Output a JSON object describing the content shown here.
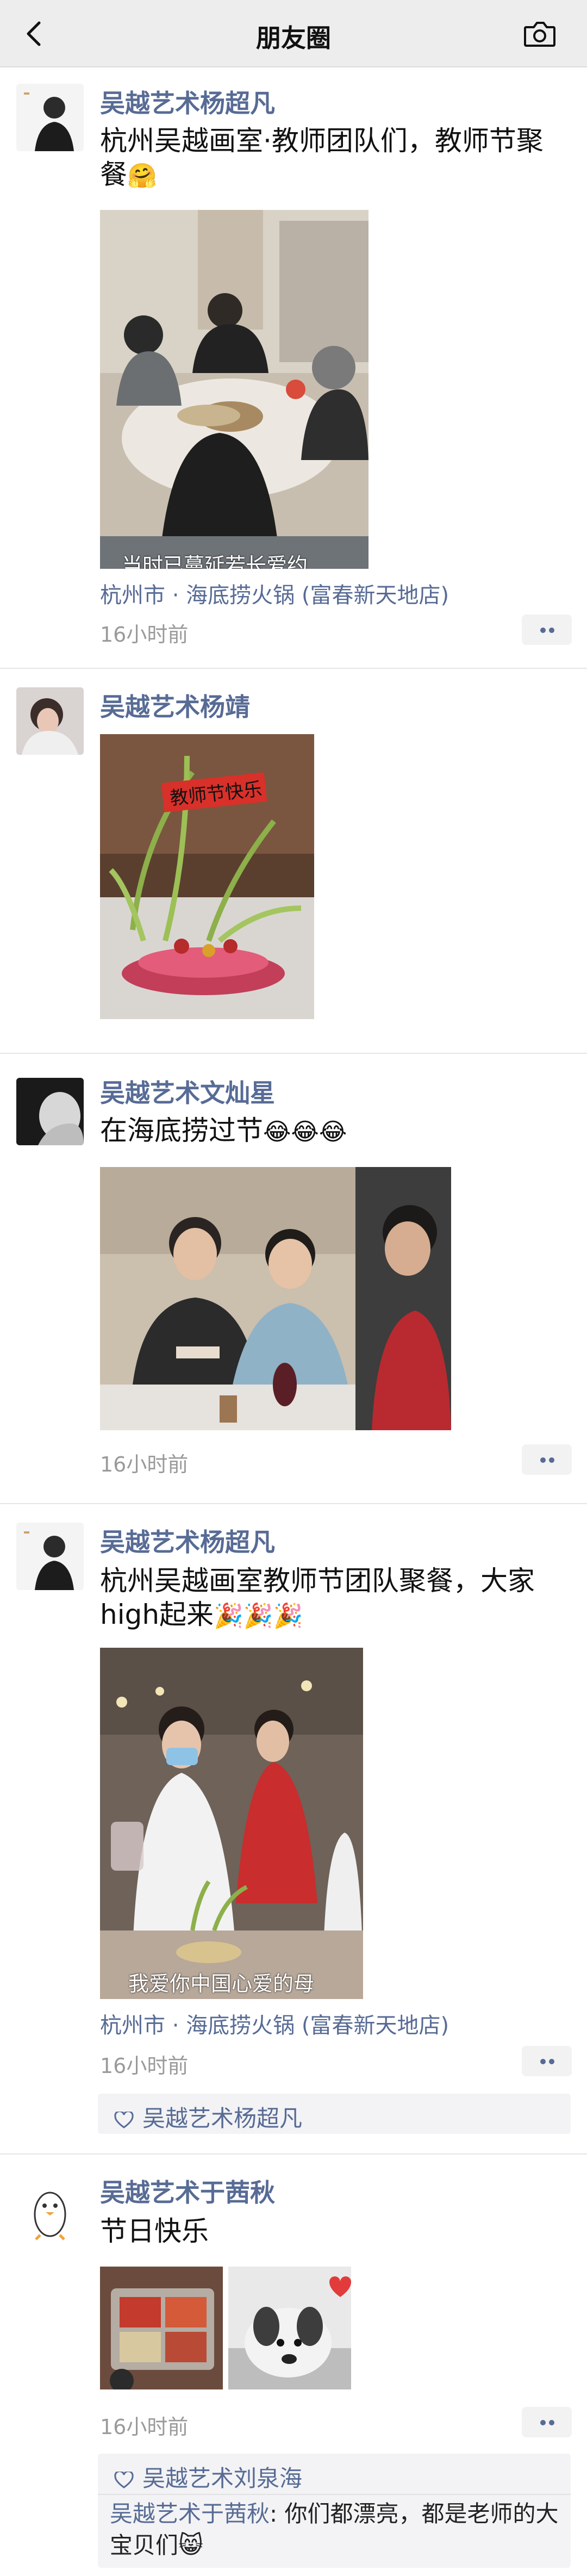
{
  "nav": {
    "title": "朋友圈"
  },
  "posts": [
    {
      "author": "吴越艺术杨超凡",
      "text": "杭州吴越画室·教师团队们，教师节聚餐",
      "emoji": "🤗",
      "image_caption": "当时已蔓延若长爱约",
      "location": "杭州市 · 海底捞火锅 (富春新天地店)",
      "time": "16小时前"
    },
    {
      "author": "吴越艺术杨靖",
      "image_text": "教师节快乐"
    },
    {
      "author": "吴越艺术文灿星",
      "text": "在海底捞过节",
      "emoji": "😂😂😂",
      "time": "16小时前"
    },
    {
      "author": "吴越艺术杨超凡",
      "text": "杭州吴越画室教师节团队聚餐，大家high起来",
      "emoji": "🎉🎉🎉",
      "image_caption": "我爱你中国心爱的母",
      "location": "杭州市 · 海底捞火锅 (富春新天地店)",
      "time": "16小时前",
      "likes": "吴越艺术杨超凡"
    },
    {
      "author": "吴越艺术于茜秋",
      "text": "节日快乐",
      "time": "16小时前",
      "likes": "吴越艺术刘泉海",
      "comment": {
        "author": "吴越艺术于茜秋",
        "text": ": 你们都漂亮，都是老师的大宝贝们",
        "emoji": "😸"
      }
    }
  ]
}
